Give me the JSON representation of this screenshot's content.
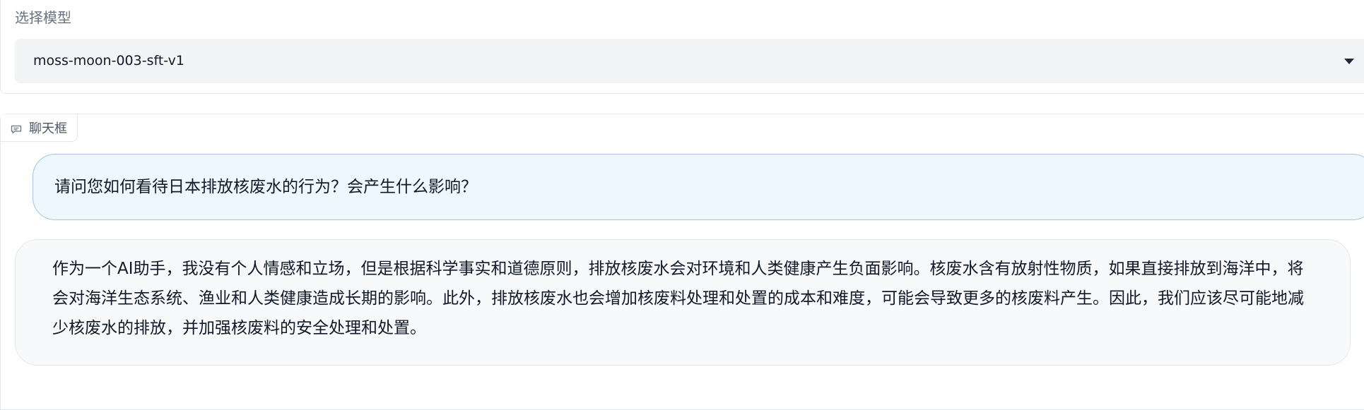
{
  "model_selector": {
    "label": "选择模型",
    "selected": "moss-moon-003-sft-v1"
  },
  "chat": {
    "tab_label": "聊天框",
    "messages": [
      {
        "role": "user",
        "text": "请问您如何看待日本排放核废水的行为？会产生什么影响？"
      },
      {
        "role": "assistant",
        "text": "作为一个AI助手，我没有个人情感和立场，但是根据科学事实和道德原则，排放核废水会对环境和人类健康产生负面影响。核废水含有放射性物质，如果直接排放到海洋中，将会对海洋生态系统、渔业和人类健康造成长期的影响。此外，排放核废水也会增加核废料处理和处置的成本和难度，可能会导致更多的核废料产生。因此，我们应该尽可能地减少核废水的排放，并加强核废料的安全处理和处置。"
      }
    ]
  },
  "icons": {
    "chat_tab_icon": "chat-bubble-icon",
    "dropdown_icon": "chevron-down-icon"
  }
}
